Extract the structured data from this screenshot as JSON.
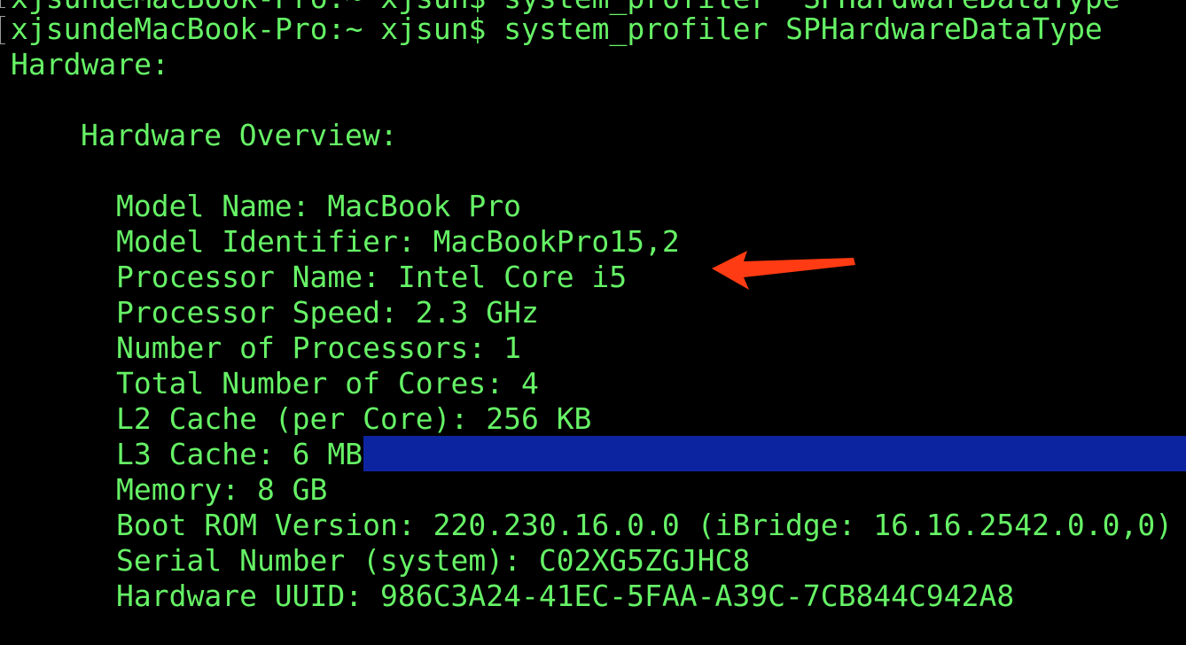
{
  "terminal": {
    "previous_line": "xjsundeMacBook-Pro:~ xjsun$ system_profiler  SPHardwareDataType",
    "prompt": "xjsundeMacBook-Pro:~ xjsun$ ",
    "command": "system_profiler SPHardwareDataType",
    "section_header": "Hardware:",
    "overview_header": "Hardware Overview:",
    "items": [
      "Model Name: MacBook Pro",
      "Model Identifier: MacBookPro15,2",
      "Processor Name: Intel Core i5",
      "Processor Speed: 2.3 GHz",
      "Number of Processors: 1",
      "Total Number of Cores: 4",
      "L2 Cache (per Core): 256 KB",
      "L3 Cache: 6 MB",
      "Memory: 8 GB",
      "Boot ROM Version: 220.230.16.0.0 (iBridge: 16.16.2542.0.0,0)",
      "Serial Number (system): C02XG5ZGJHC8",
      "Hardware UUID: 986C3A24-41EC-5FAA-A39C-7CB844C942A8"
    ]
  },
  "colors": {
    "background": "#000000",
    "text": "#66f266",
    "selection": "#0d24a0",
    "arrow": "#ff3b14"
  },
  "annotation": {
    "icon": "red-arrow-icon"
  }
}
